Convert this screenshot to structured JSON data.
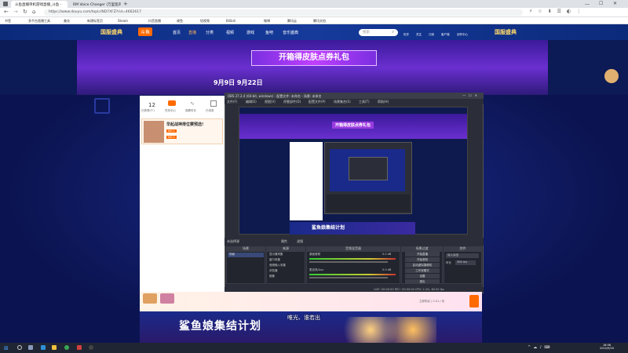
{
  "browser": {
    "tabs": [
      {
        "title": "斗鱼直播单机游戏直播_斗鱼 -",
        "active": true
      },
      {
        "title": "RM Voice Changer (万里变声) -",
        "active": false
      }
    ],
    "url": "https://www.douyu.com/topic/ND7XFZ?rid=4662617",
    "bookmarks": [
      "书签",
      "多平台直播工具",
      "美化",
      "新建标签页",
      "Steam",
      "抖音直播",
      "咸鱼",
      "短视频",
      "Bilibili",
      "微博",
      "腾讯云",
      "腾讯文档"
    ]
  },
  "site_nav": {
    "logo_left": "国服盛典",
    "logo_brand": "斗鱼",
    "items": [
      "首页",
      "直播",
      "分类",
      "视频",
      "游戏",
      "鱼吧",
      "音乐盛典"
    ],
    "search_placeholder": "搜索",
    "user_items": [
      "历史",
      "关注",
      "订阅",
      "客户端",
      "创作中心"
    ],
    "logo_right": "国服盛典"
  },
  "banner": {
    "title": "开箱得皮肤点券礼包",
    "date_range": "9月9日  9月22日"
  },
  "left_panel": {
    "stat_count": "12",
    "stat_labels": [
      "已获得(个)",
      "任务中心",
      "观看时长",
      "已领奖"
    ],
    "promo_title": "早起战神排位赛预选!",
    "promo_lines": [
      "NO.1",
      "NO.2"
    ]
  },
  "obs": {
    "title": "OBS 27.2.4 (64-bit, windows) - 配置文件: 未命名 - 场景: 未命名",
    "menu": [
      "文件(F)",
      "编辑(E)",
      "视图(V)",
      "停靠部件(D)",
      "配置文件(P)",
      "场景集合(S)",
      "工具(T)",
      "帮助(H)"
    ],
    "preview_banner": "开箱得皮肤点券礼包",
    "preview_footer": "鲨鱼娘集结计划",
    "dock_labels": [
      "未选择源",
      "属性",
      "滤镜"
    ],
    "dock_headers": [
      "场景",
      "来源",
      "音频混音器",
      "场景过渡",
      "控件"
    ],
    "scene_item": "场景",
    "sources": [
      "显示器采集",
      "窗口采集",
      "音频输入采集",
      "浏览器",
      "图像"
    ],
    "mixer": [
      {
        "name": "桌面音频",
        "db": "0.0 dB"
      },
      {
        "name": "麦克风/Aux",
        "db": "0.0 dB"
      }
    ],
    "transition": {
      "type": "淡入淡出",
      "duration_label": "时长",
      "duration": "300 ms"
    },
    "controls": [
      "开始直播",
      "开始录制",
      "启动虚拟摄像机",
      "工作室模式",
      "设置",
      "退出"
    ],
    "status": "LIVE: 00:00:00   REC: 00:00:00   CPU: 2.4%, 60.00 fps"
  },
  "bottom": {
    "footer_art": "鲨鱼娘集结计划",
    "danmaku": "唯光、谁若出",
    "coupon_label": "立即购买 | 0.01 / 份"
  },
  "taskbar": {
    "time": "16:06",
    "date": "2022/9/20"
  },
  "colors": {
    "site_blue": "#0c2a7a",
    "banner_purple": "#6a2fd0",
    "obs_dark": "#2b2e38",
    "accent_orange": "#ff6a00"
  }
}
